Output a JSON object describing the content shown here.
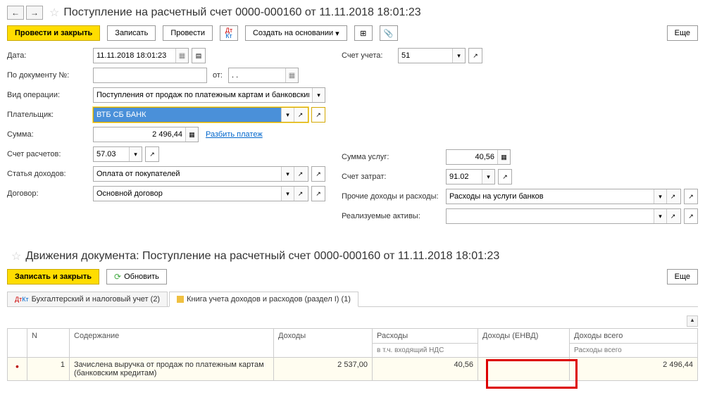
{
  "nav": {
    "back": "←",
    "forward": "→"
  },
  "header": {
    "title": "Поступление на расчетный счет 0000-000160 от 11.11.2018 18:01:23"
  },
  "toolbar": {
    "post_close": "Провести и закрыть",
    "write": "Записать",
    "post": "Провести",
    "create_based": "Создать на основании",
    "more": "Еще"
  },
  "form": {
    "date_label": "Дата:",
    "date_value": "11.11.2018 18:01:23",
    "account_label": "Счет учета:",
    "account_value": "51",
    "doc_num_label": "По документу №:",
    "doc_num_value": "",
    "from_label": "от:",
    "from_value": ". .",
    "op_type_label": "Вид операции:",
    "op_type_value": "Поступления от продаж по платежным картам и банковским кре",
    "payer_label": "Плательщик:",
    "payer_value": "ВТБ СБ БАНК",
    "sum_label": "Сумма:",
    "sum_value": "2 496,44",
    "split_link": "Разбить платеж",
    "settle_acc_label": "Счет расчетов:",
    "settle_acc_value": "57.03",
    "services_sum_label": "Сумма услуг:",
    "services_sum_value": "40,56",
    "income_item_label": "Статья доходов:",
    "income_item_value": "Оплата от покупателей",
    "cost_acc_label": "Счет затрат:",
    "cost_acc_value": "91.02",
    "contract_label": "Договор:",
    "contract_value": "Основной договор",
    "other_label": "Прочие доходы и расходы:",
    "other_value": "Расходы на услуги банков",
    "assets_label": "Реализуемые активы:",
    "assets_value": ""
  },
  "section2": {
    "title": "Движения документа: Поступление на расчетный счет 0000-000160 от 11.11.2018 18:01:23",
    "write_close": "Записать и закрыть",
    "refresh": "Обновить",
    "more": "Еще",
    "tab1": "Бухгалтерский и налоговый учет (2)",
    "tab2": "Книга учета доходов и расходов (раздел I) (1)"
  },
  "table": {
    "col_n": "N",
    "col_content": "Содержание",
    "col_income": "Доходы",
    "col_expense": "Расходы",
    "col_income_envd": "Доходы (ЕНВД)",
    "col_income_total": "Доходы всего",
    "col_vat": "в т.ч. входящий НДС",
    "col_expense_total": "Расходы всего",
    "row": {
      "n": "1",
      "content": "Зачислена выручка от продаж по платежным картам (банковским кредитам)",
      "income": "2 537,00",
      "expense": "40,56",
      "income_envd": "",
      "income_total": "2 496,44"
    }
  }
}
